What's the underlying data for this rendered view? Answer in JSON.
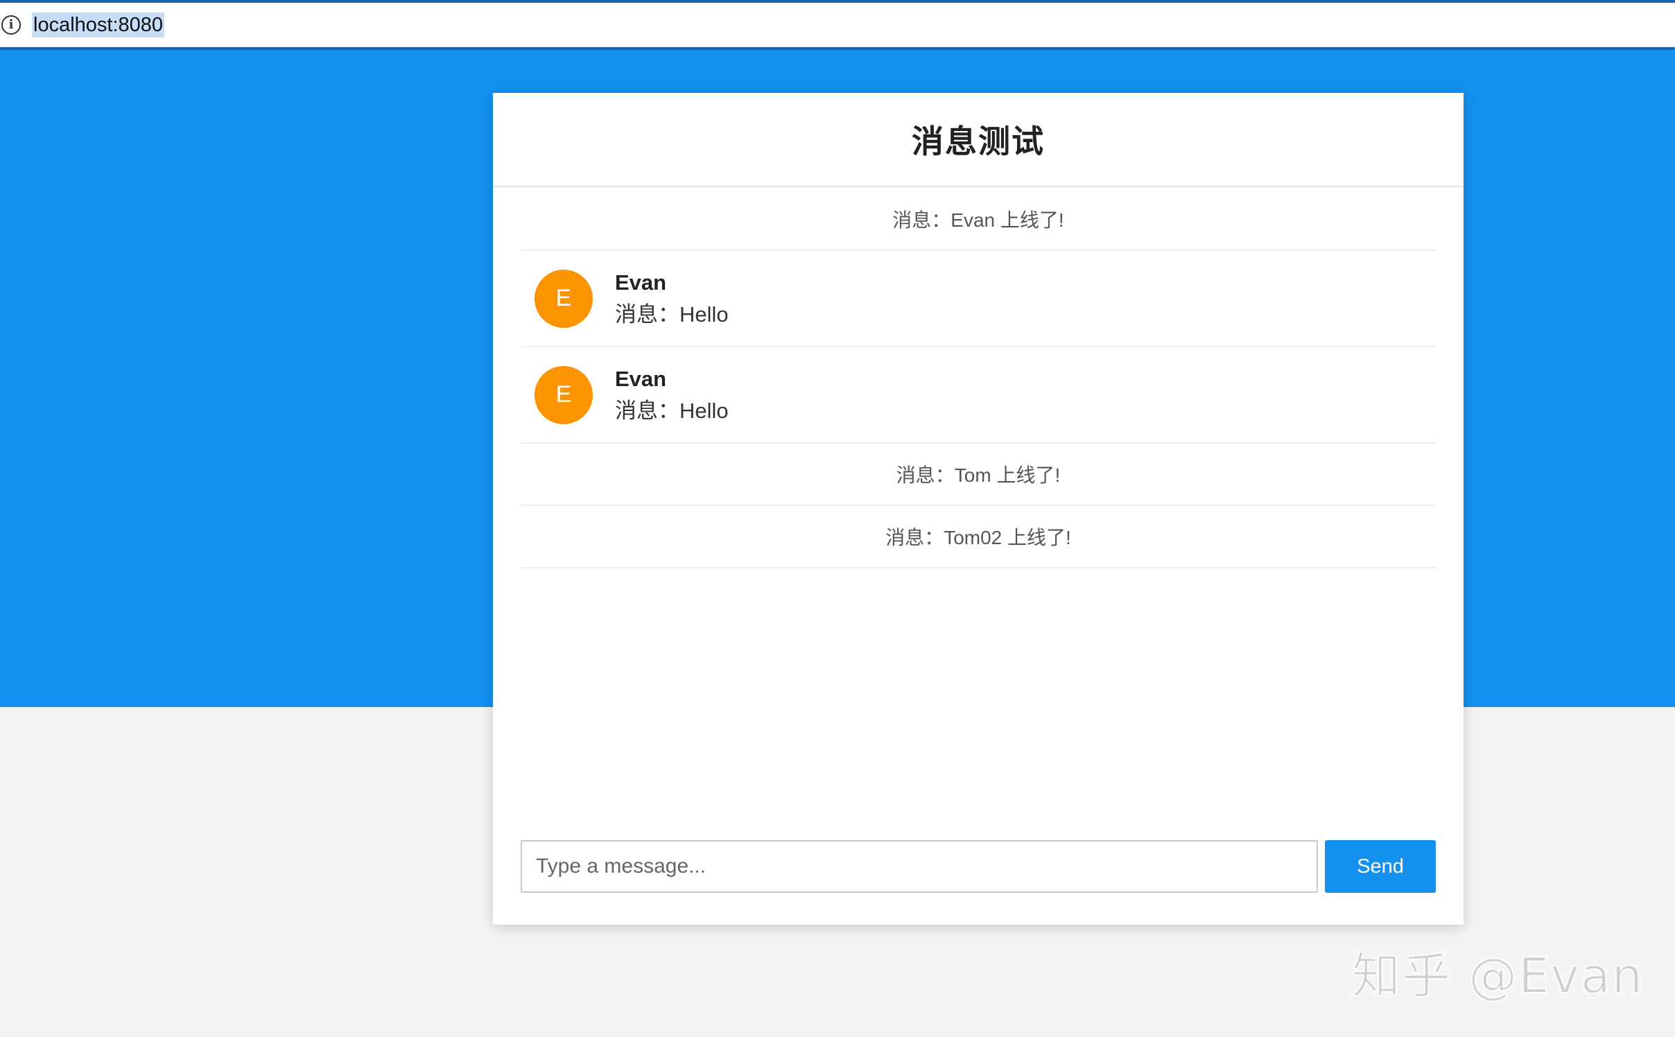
{
  "browser": {
    "url": "localhost:8080",
    "info_icon": "info-icon"
  },
  "colors": {
    "brand_blue": "#1390f0",
    "avatar_orange": "#fb9400",
    "page_bg": "#f4f4f4"
  },
  "chat": {
    "title": "消息测试",
    "messages": [
      {
        "type": "system",
        "text": "消息：Evan 上线了!"
      },
      {
        "type": "user",
        "avatar_letter": "E",
        "author": "Evan",
        "text": "消息：Hello"
      },
      {
        "type": "user",
        "avatar_letter": "E",
        "author": "Evan",
        "text": "消息：Hello"
      },
      {
        "type": "system",
        "text": "消息：Tom 上线了!"
      },
      {
        "type": "system",
        "text": "消息：Tom02 上线了!"
      }
    ],
    "composer": {
      "placeholder": "Type a message...",
      "value": "",
      "send_label": "Send"
    }
  },
  "watermark": "知乎 @Evan"
}
